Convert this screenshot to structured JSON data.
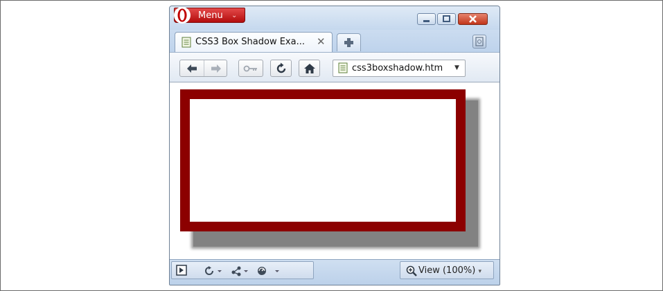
{
  "titlebar": {
    "menu_label": "Menu",
    "menu_chevron": "⌄"
  },
  "tab": {
    "title": "CSS3 Box Shadow Exa...",
    "close": "✕"
  },
  "address": {
    "url": "css3boxshadow.htm",
    "dropdown": "▼"
  },
  "statusbar": {
    "view_label": "View (100%)",
    "view_chevron": "▾"
  },
  "colors": {
    "box_border": "#8c0000",
    "shadow": "#828282",
    "menu_red": "#cc1a1a"
  },
  "icons": [
    "opera-logo-icon",
    "minimize-icon",
    "maximize-icon",
    "close-icon",
    "page-icon",
    "new-tab-icon",
    "trash-icon",
    "back-icon",
    "forward-icon",
    "key-icon",
    "reload-icon",
    "home-icon",
    "panel-toggle-icon",
    "sync-icon",
    "unite-icon",
    "turbo-icon",
    "zoom-icon"
  ]
}
